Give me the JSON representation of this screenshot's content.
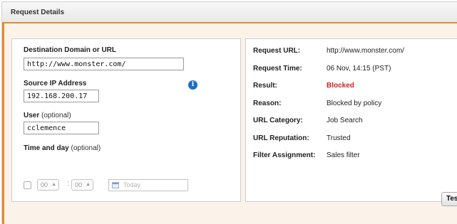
{
  "header": {
    "title": "Request Details"
  },
  "form": {
    "destination": {
      "label": "Destination Domain or URL",
      "value": "http://www.monster.com/"
    },
    "source_ip": {
      "label": "Source IP Address",
      "value": "192.168.200.17"
    },
    "user": {
      "label": "User",
      "optional": "(optional)",
      "value": "cclemence"
    },
    "time": {
      "label": "Time and day",
      "optional": "(optional)",
      "hour": "00",
      "minute": "00",
      "separator": ":",
      "date_placeholder": "Today"
    }
  },
  "details": {
    "rows": [
      {
        "label": "Request URL:",
        "value": "http://www.monster.com/"
      },
      {
        "label": "Request Time:",
        "value": "06 Nov, 14:15 (PST)"
      },
      {
        "label": "Result:",
        "value": "Blocked"
      },
      {
        "label": "Reason:",
        "value": "Blocked by policy"
      },
      {
        "label": "URL Category:",
        "value": "Job Search"
      },
      {
        "label": "URL Reputation:",
        "value": "Trusted"
      },
      {
        "label": "Filter Assignment:",
        "value": "Sales filter"
      }
    ]
  },
  "footer": {
    "test_button_label": "Test"
  },
  "colors": {
    "accent": "#e8892b",
    "blocked": "#d42020",
    "info": "#1b6fc4",
    "content_bg": "#fbf3e9"
  },
  "icons": {
    "info": "info-icon",
    "calendar": "calendar-icon",
    "stepper_arrows": "up-down-arrows-icon"
  }
}
